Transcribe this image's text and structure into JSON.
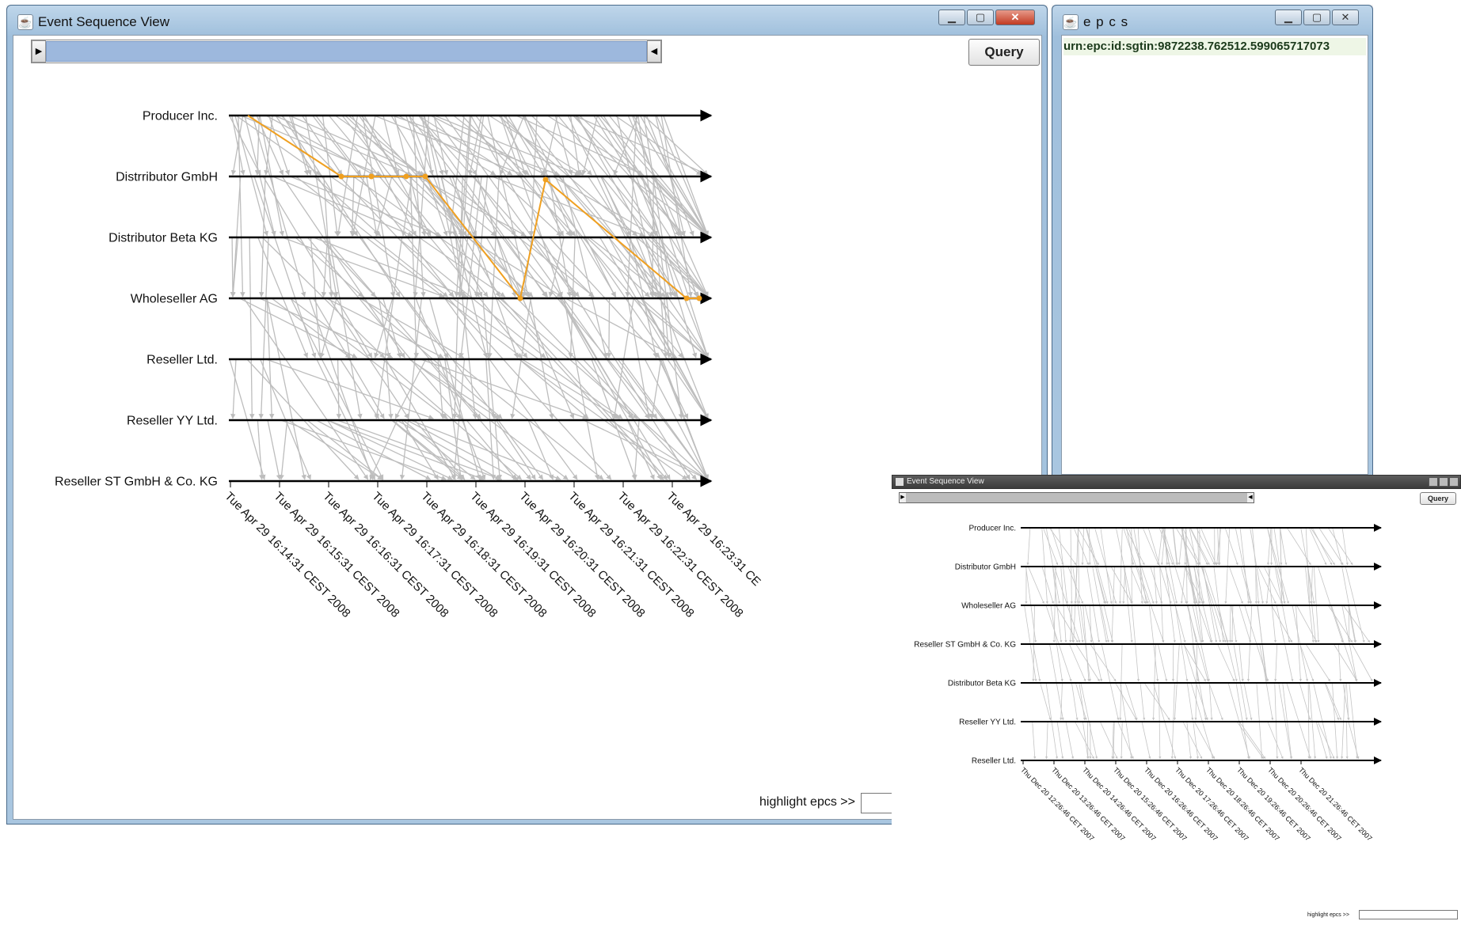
{
  "main_window": {
    "title": "Event Sequence View",
    "query_button": "Query",
    "highlight_label": "highlight epcs >>",
    "lanes": [
      "Producer Inc.",
      "Distrributor GmbH",
      "Distributor Beta KG",
      "Wholeseller AG",
      "Reseller Ltd.",
      "Reseller YY Ltd.",
      "Reseller ST GmbH & Co. KG"
    ],
    "time_ticks": [
      "Tue Apr 29 16:14:31 CEST 2008",
      "Tue Apr 29 16:15:31 CEST 2008",
      "Tue Apr 29 16:16:31 CEST 2008",
      "Tue Apr 29 16:17:31 CEST 2008",
      "Tue Apr 29 16:18:31 CEST 2008",
      "Tue Apr 29 16:19:31 CEST 2008",
      "Tue Apr 29 16:20:31 CEST 2008",
      "Tue Apr 29 16:21:31 CEST 2008",
      "Tue Apr 29 16:22:31 CEST 2008",
      "Tue Apr 29 16:23:31 CE"
    ],
    "edge_color": "#bdbdbd",
    "highlight_color": "#f0a020"
  },
  "epcs_window": {
    "title": "e p c s",
    "items": [
      "urn:epc:id:sgtin:9872238.762512.599065717073"
    ],
    "item_bg": "#eef6e6"
  },
  "inset_window": {
    "title": "Event Sequence View",
    "query_button": "Query",
    "highlight_label": "highlight epcs >>",
    "lanes": [
      "Producer Inc.",
      "Distributor GmbH",
      "Wholeseller AG",
      "Reseller ST GmbH & Co. KG",
      "Distributor Beta KG",
      "Reseller YY Ltd.",
      "Reseller Ltd."
    ],
    "time_ticks": [
      "Thu Dec 20 12:26:46 CET 2007",
      "Thu Dec 20 13:26:46 CET 2007",
      "Thu Dec 20 14:26:46 CET 2007",
      "Thu Dec 20 15:26:46 CET 2007",
      "Thu Dec 20 16:26:46 CET 2007",
      "Thu Dec 20 17:26:46 CET 2007",
      "Thu Dec 20 18:26:46 CET 2007",
      "Thu Dec 20 19:26:46 CET 2007",
      "Thu Dec 20 20:26:46 CET 2007",
      "Thu Dec 20 21:26:46 CET 2007"
    ]
  }
}
